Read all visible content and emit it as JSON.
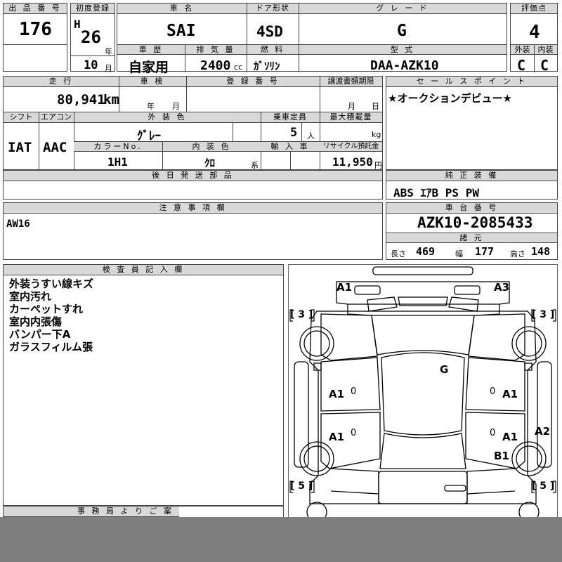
{
  "header": {
    "lot_no_label": "出 品 番 号",
    "lot_no": "176",
    "first_reg_label": "初度登録",
    "era": "H",
    "year": "26",
    "year_unit": "年",
    "month": "10",
    "month_unit": "月",
    "car_name_label": "車 名",
    "car_name": "SAI",
    "door_label": "ドア形状",
    "door": "4SD",
    "grade_label": "グ レ ー ド",
    "grade": "G",
    "score_label": "評価点",
    "score": "4",
    "history_label": "車 歴",
    "history": "自家用",
    "displacement_label": "排 気 量",
    "displacement": "2400",
    "displacement_unit": "cc",
    "fuel_label": "燃 料",
    "fuel": "ｶﾞｿﾘﾝ",
    "model_label": "型 式",
    "model": "DAA-AZK10",
    "exterior_label": "外装",
    "exterior": "C",
    "interior_label": "内装",
    "interior": "C"
  },
  "mid": {
    "mileage_label": "走 行",
    "mileage": "80,941",
    "mileage_unit": "km",
    "inspection_label": "車 検",
    "insp_year_unit": "年",
    "insp_month_unit": "月",
    "reg_no_label": "登 録 番 号",
    "transfer_label": "譲渡書類期限",
    "transfer_month_unit": "月",
    "transfer_day_unit": "日",
    "shift_label": "シフト",
    "shift": "IAT",
    "ac_label": "エアコン",
    "ac": "AAC",
    "ext_color_label": "外 装 色",
    "ext_color": "ｸﾞﾚｰ",
    "capacity_label": "乗車定員",
    "capacity": "5",
    "capacity_unit": "人",
    "max_load_label": "最大積載量",
    "max_load_unit": "kg",
    "color_no_label": "カラーNo.",
    "color_no": "1H1",
    "int_color_label": "内 装 色",
    "int_color": "ｸﾛ",
    "int_color_unit": "系",
    "import_label": "輸 入 車",
    "recycle_label": "リサイクル預託金",
    "recycle": "11,950",
    "recycle_unit": "円",
    "later_parts_label": "後 日 発 送 部 品",
    "sales_point_label": "セ ー ル ス ポ イ ン ト",
    "sales_point": "★オークションデビュー★",
    "equipment_label": "純 正 装 備",
    "equipment": "ABS ｴｱB PS PW"
  },
  "notes": {
    "label": "注 意 事 項 欄",
    "text": "AW16"
  },
  "chassis": {
    "label": "車 台 番 号",
    "value": "AZK10-2085433",
    "dims_label": "諸 元",
    "length_label": "長さ",
    "length": "469",
    "width_label": "幅",
    "width": "177",
    "height_label": "高さ",
    "height": "148"
  },
  "inspector": {
    "label": "検 査 員 記 入 欄",
    "lines": [
      "外装うすい線キズ",
      "室内汚れ",
      "カーペットすれ",
      "室内内張傷",
      "バンパー下A",
      "ガラスフィルム張"
    ]
  },
  "office_label": "事 務 局 よ り ご 案",
  "diagram": {
    "marks": {
      "a1_front_left": "A1",
      "a3_front_right": "A3",
      "tire_fl": "[ 3 ]",
      "tire_fr": "[ 3 ]",
      "g_windshield": "G",
      "a1_fl_door": "A1",
      "zero_1": "0",
      "zero_2": "0",
      "a1_fr_door": "A1",
      "a1_rl_door": "A1",
      "zero_3": "0",
      "zero_4": "0",
      "a1_rr_door": "A1",
      "a2_rear_right": "A2",
      "b1_rear_right": "B1",
      "tire_rl": "[ 5 ]",
      "tire_rr": "[ 5 ]"
    }
  }
}
